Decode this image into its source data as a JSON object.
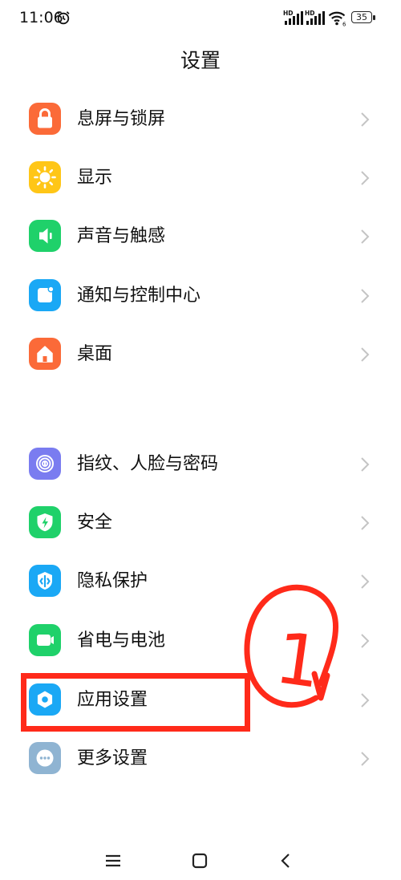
{
  "status_bar": {
    "time": "11:06",
    "signal_1_label": "HD",
    "signal_2_label": "HD",
    "wifi_sub": "6",
    "battery": "35"
  },
  "page": {
    "title": "设置"
  },
  "section_1": [
    {
      "label": "息屏与锁屏",
      "icon": "lock-icon",
      "color": "#fb6a38"
    },
    {
      "label": "显示",
      "icon": "sun-icon",
      "color": "#ffc617"
    },
    {
      "label": "声音与触感",
      "icon": "speaker-icon",
      "color": "#1fd16a"
    },
    {
      "label": "通知与控制中心",
      "icon": "notification-icon",
      "color": "#1aa8f5"
    },
    {
      "label": "桌面",
      "icon": "home-icon",
      "color": "#fb6a38"
    }
  ],
  "section_2": [
    {
      "label": "指纹、人脸与密码",
      "icon": "fingerprint-icon",
      "color": "#7a7cf0"
    },
    {
      "label": "安全",
      "icon": "shield-bolt-icon",
      "color": "#1fd16a"
    },
    {
      "label": "隐私保护",
      "icon": "privacy-icon",
      "color": "#1aa8f5"
    },
    {
      "label": "省电与电池",
      "icon": "battery-saver-icon",
      "color": "#1fd16a"
    },
    {
      "label": "应用设置",
      "icon": "gear-icon",
      "color": "#1aa8f5"
    },
    {
      "label": "更多设置",
      "icon": "more-dots-icon",
      "color": "#8fb4d2"
    }
  ],
  "annotation": {
    "color": "#ff2a1a",
    "mark": "1"
  }
}
